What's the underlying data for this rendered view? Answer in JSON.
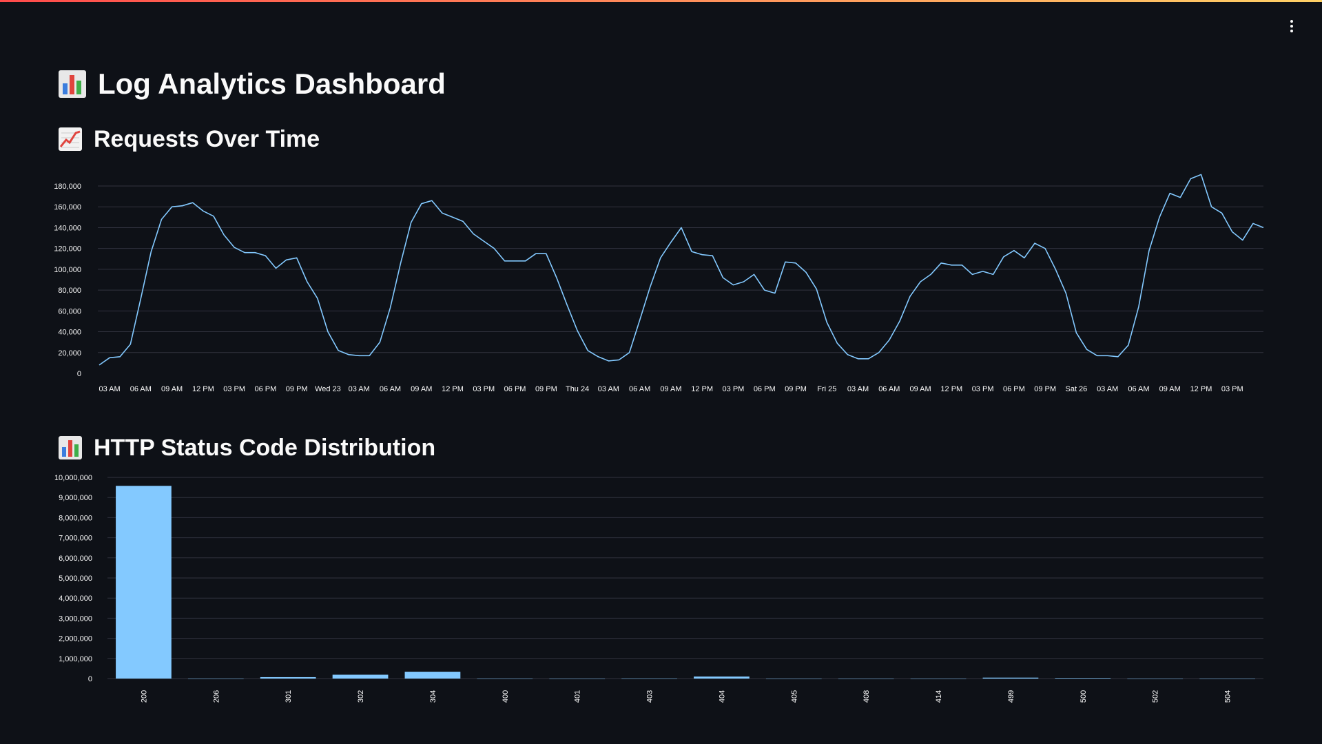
{
  "app": {
    "title": "Log Analytics Dashboard",
    "accent_gradient": [
      "#ff4b4b",
      "#ffd166"
    ],
    "menu_icon": "vertical-dots-icon"
  },
  "sections": {
    "requests": {
      "title": "Requests Over Time",
      "icon": "line-chart-emoji-icon"
    },
    "status": {
      "title": "HTTP Status Code Distribution",
      "icon": "bar-chart-emoji-icon"
    }
  },
  "colors": {
    "background": "#0e1117",
    "line": "#83c9ff",
    "bar": "#83c9ff",
    "grid": "#31333f",
    "text": "#fafafa"
  },
  "chart_data": [
    {
      "type": "line",
      "title": "",
      "xlabel": "",
      "ylabel": "",
      "ylim": [
        0,
        180000
      ],
      "yticks": [
        "0",
        "20,000",
        "40,000",
        "60,000",
        "80,000",
        "100,000",
        "120,000",
        "140,000",
        "160,000",
        "180,000"
      ],
      "xticks": [
        "03 AM",
        "06 AM",
        "09 AM",
        "12 PM",
        "03 PM",
        "06 PM",
        "09 PM",
        "Wed 23",
        "03 AM",
        "06 AM",
        "09 AM",
        "12 PM",
        "03 PM",
        "06 PM",
        "09 PM",
        "Thu 24",
        "03 AM",
        "06 AM",
        "09 AM",
        "12 PM",
        "03 PM",
        "06 PM",
        "09 PM",
        "Fri 25",
        "03 AM",
        "06 AM",
        "09 AM",
        "12 PM",
        "03 PM",
        "06 PM",
        "09 PM",
        "Sat 26",
        "03 AM",
        "06 AM",
        "09 AM",
        "12 PM",
        "03 PM"
      ],
      "x_start": "02:00",
      "x_step_hours": 1,
      "grid": true,
      "series": [
        {
          "values": [
            8000,
            15000,
            16000,
            28000,
            72000,
            117000,
            148000,
            160000,
            161000,
            164000,
            156000,
            151000,
            133000,
            121000,
            116000,
            116000,
            113000,
            101000,
            109000,
            111000,
            88000,
            72000,
            40000,
            22000,
            18000,
            17000,
            17000,
            30000,
            63000,
            106000,
            145000,
            163000,
            166000,
            154000,
            150000,
            146000,
            134000,
            127000,
            120000,
            108000,
            108000,
            108000,
            115000,
            115000,
            92000,
            66000,
            41000,
            22000,
            16000,
            12000,
            13000,
            20000,
            51000,
            83000,
            111000,
            126000,
            140000,
            117000,
            114000,
            113000,
            92000,
            85000,
            88000,
            95000,
            80000,
            77000,
            107000,
            106000,
            97000,
            81000,
            49000,
            29000,
            18000,
            14000,
            14000,
            20000,
            32000,
            50000,
            74000,
            88000,
            95000,
            106000,
            104000,
            104000,
            95000,
            98000,
            95000,
            112000,
            118000,
            111000,
            125000,
            120000,
            100000,
            77000,
            39000,
            23000,
            17000,
            17000,
            16000,
            27000,
            64000,
            118000,
            150000,
            173000,
            169000,
            187000,
            191000,
            160000,
            154000,
            136000,
            128000,
            144000,
            140000
          ]
        }
      ]
    },
    {
      "type": "bar",
      "title": "",
      "xlabel": "",
      "ylabel": "",
      "ylim": [
        0,
        10000000
      ],
      "yticks": [
        "0",
        "1,000,000",
        "2,000,000",
        "3,000,000",
        "4,000,000",
        "5,000,000",
        "6,000,000",
        "7,000,000",
        "8,000,000",
        "9,000,000",
        "10,000,000"
      ],
      "categories": [
        "200",
        "206",
        "301",
        "302",
        "304",
        "400",
        "401",
        "403",
        "404",
        "405",
        "408",
        "414",
        "499",
        "500",
        "502",
        "504"
      ],
      "values": [
        9580000,
        3000,
        70000,
        190000,
        340000,
        5000,
        1000,
        8000,
        100000,
        1000,
        1000,
        1000,
        45000,
        25000,
        1000,
        2000
      ],
      "grid": true
    }
  ]
}
